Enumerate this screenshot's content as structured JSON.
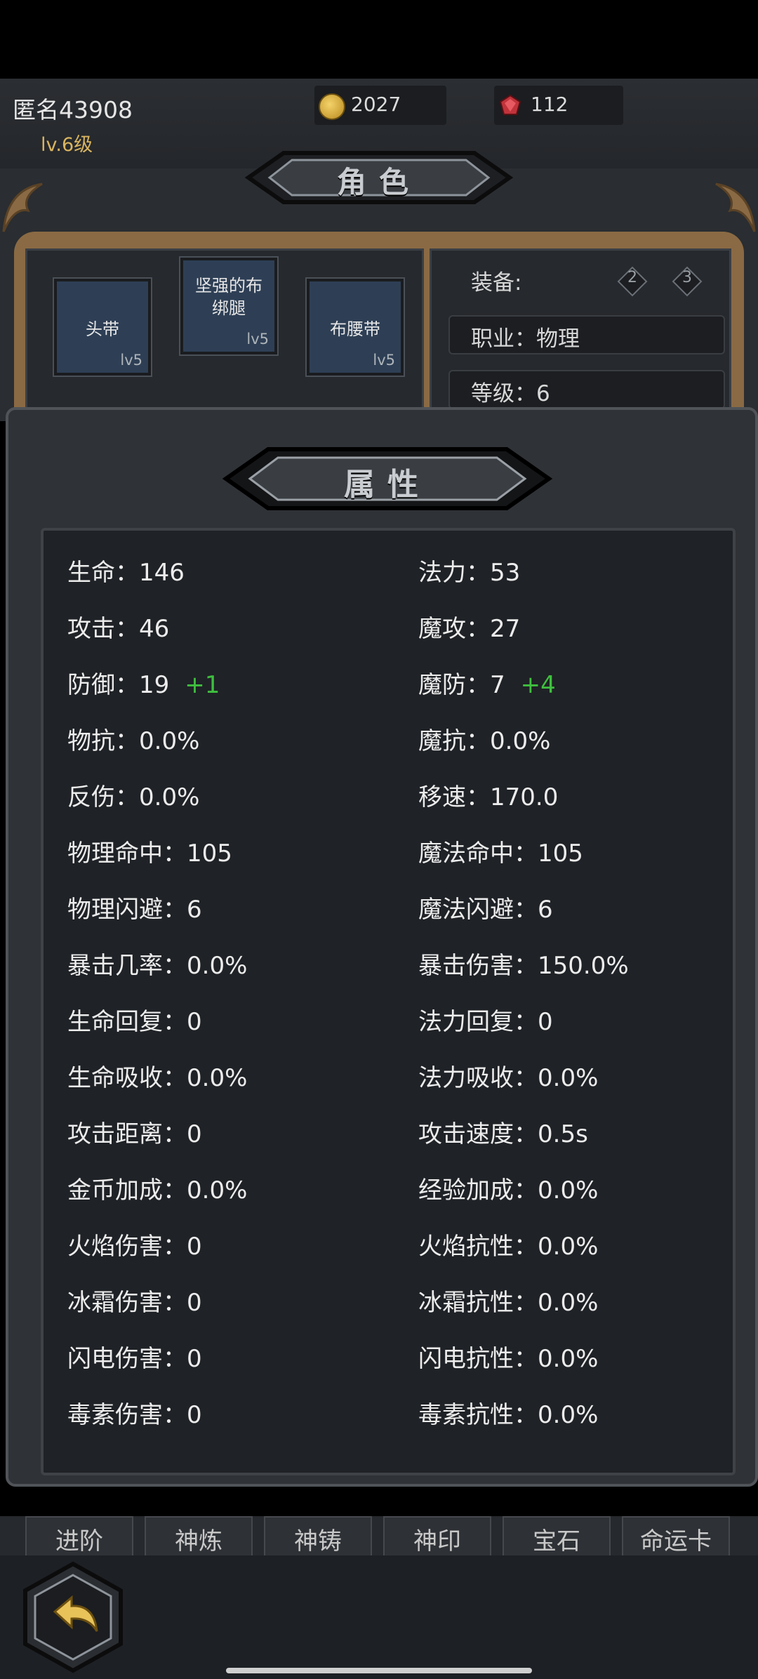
{
  "header": {
    "player_name": "匿名43908",
    "player_level": "lv.6级",
    "coins": "2027",
    "gems": "112"
  },
  "role_banner": "角色",
  "equipment": {
    "slots": [
      {
        "label": "头带",
        "level": "lv5"
      },
      {
        "label": "坚强的布绑腿",
        "level": "lv5"
      },
      {
        "label": "布腰带",
        "level": "lv5"
      }
    ],
    "info_title": "装备:",
    "badges": [
      "2",
      "3"
    ],
    "class_row": "职业：物理",
    "level_row": "等级：6"
  },
  "attributes": {
    "title": "属性",
    "left": [
      {
        "label": "生命：",
        "value": "146",
        "bonus": ""
      },
      {
        "label": "攻击：",
        "value": "46",
        "bonus": ""
      },
      {
        "label": "防御：",
        "value": "19",
        "bonus": "+1"
      },
      {
        "label": "物抗：",
        "value": "0.0%",
        "bonus": ""
      },
      {
        "label": "反伤：",
        "value": "0.0%",
        "bonus": ""
      },
      {
        "label": "物理命中：",
        "value": "105",
        "bonus": ""
      },
      {
        "label": "物理闪避：",
        "value": "6",
        "bonus": ""
      },
      {
        "label": "暴击几率：",
        "value": "0.0%",
        "bonus": ""
      },
      {
        "label": "生命回复：",
        "value": "0",
        "bonus": ""
      },
      {
        "label": "生命吸收：",
        "value": "0.0%",
        "bonus": ""
      },
      {
        "label": "攻击距离：",
        "value": "0",
        "bonus": ""
      },
      {
        "label": "金币加成：",
        "value": "0.0%",
        "bonus": ""
      },
      {
        "label": "火焰伤害：",
        "value": "0",
        "bonus": ""
      },
      {
        "label": "冰霜伤害：",
        "value": "0",
        "bonus": ""
      },
      {
        "label": "闪电伤害：",
        "value": "0",
        "bonus": ""
      },
      {
        "label": "毒素伤害：",
        "value": "0",
        "bonus": ""
      }
    ],
    "right": [
      {
        "label": "法力：",
        "value": "53",
        "bonus": ""
      },
      {
        "label": "魔攻：",
        "value": "27",
        "bonus": ""
      },
      {
        "label": "魔防：",
        "value": "7",
        "bonus": "+4"
      },
      {
        "label": "魔抗：",
        "value": "0.0%",
        "bonus": ""
      },
      {
        "label": "移速：",
        "value": "170.0",
        "bonus": ""
      },
      {
        "label": "魔法命中：",
        "value": "105",
        "bonus": ""
      },
      {
        "label": "魔法闪避：",
        "value": "6",
        "bonus": ""
      },
      {
        "label": "暴击伤害：",
        "value": "150.0%",
        "bonus": ""
      },
      {
        "label": "法力回复：",
        "value": "0",
        "bonus": ""
      },
      {
        "label": "法力吸收：",
        "value": "0.0%",
        "bonus": ""
      },
      {
        "label": "攻击速度：",
        "value": "0.5s",
        "bonus": ""
      },
      {
        "label": "经验加成：",
        "value": "0.0%",
        "bonus": ""
      },
      {
        "label": "火焰抗性：",
        "value": "0.0%",
        "bonus": ""
      },
      {
        "label": "冰霜抗性：",
        "value": "0.0%",
        "bonus": ""
      },
      {
        "label": "闪电抗性：",
        "value": "0.0%",
        "bonus": ""
      },
      {
        "label": "毒素抗性：",
        "value": "0.0%",
        "bonus": ""
      }
    ]
  },
  "tabs": [
    "进阶",
    "神炼",
    "神铸",
    "神印",
    "宝石",
    "命运卡"
  ],
  "colors": {
    "bonus_green": "#3fbf3f",
    "level_gold": "#d9b560",
    "panel_bg": "#1f2226"
  },
  "icons": {
    "coin": "gold-coin-icon",
    "gem": "red-gem-icon",
    "back": "back-arrow-icon"
  }
}
